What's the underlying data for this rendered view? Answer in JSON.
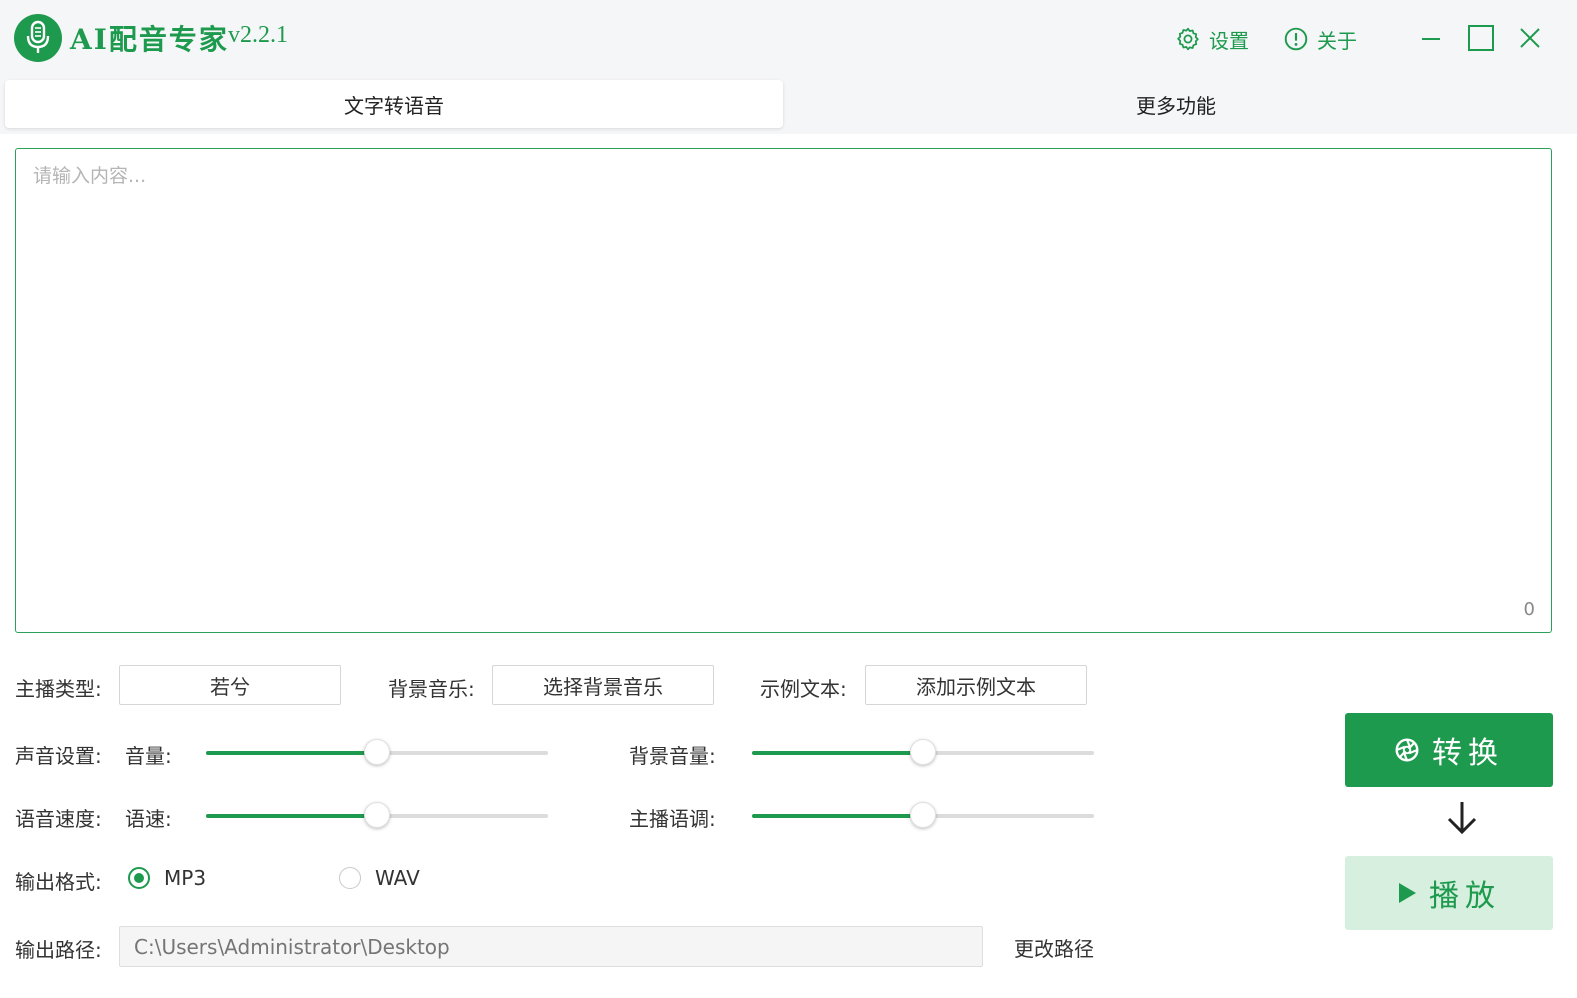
{
  "app": {
    "name": "AI配音专家",
    "version": "v2.2.1"
  },
  "header": {
    "settings_label": "设置",
    "about_label": "关于"
  },
  "tabs": [
    {
      "label": "文字转语音",
      "active": true
    },
    {
      "label": "更多功能",
      "active": false
    }
  ],
  "editor": {
    "placeholder": "请输入内容...",
    "char_count": "0"
  },
  "controls": {
    "anchor_type_label": "主播类型:",
    "anchor_type_value": "若兮",
    "bg_music_label": "背景音乐:",
    "bg_music_button": "选择背景音乐",
    "sample_text_label": "示例文本:",
    "sample_text_button": "添加示例文本",
    "sound_settings_label": "声音设置:",
    "volume_label": "音量:",
    "volume_value": 0.5,
    "bg_volume_label": "背景音量:",
    "bg_volume_value": 0.5,
    "speed_section_label": "语音速度:",
    "speed_label": "语速:",
    "speed_value": 0.5,
    "pitch_label": "主播语调:",
    "pitch_value": 0.5,
    "format_label": "输出格式:",
    "format_options": [
      {
        "label": "MP3",
        "checked": true
      },
      {
        "label": "WAV",
        "checked": false
      }
    ],
    "output_path_label": "输出路径:",
    "output_path_placeholder": "C:\\Users\\Administrator\\Desktop",
    "change_path_label": "更改路径"
  },
  "actions": {
    "convert_label": "转换",
    "play_label": "播放"
  },
  "colors": {
    "accent": "#1e9a4e",
    "accent_light": "#d6efdf"
  }
}
